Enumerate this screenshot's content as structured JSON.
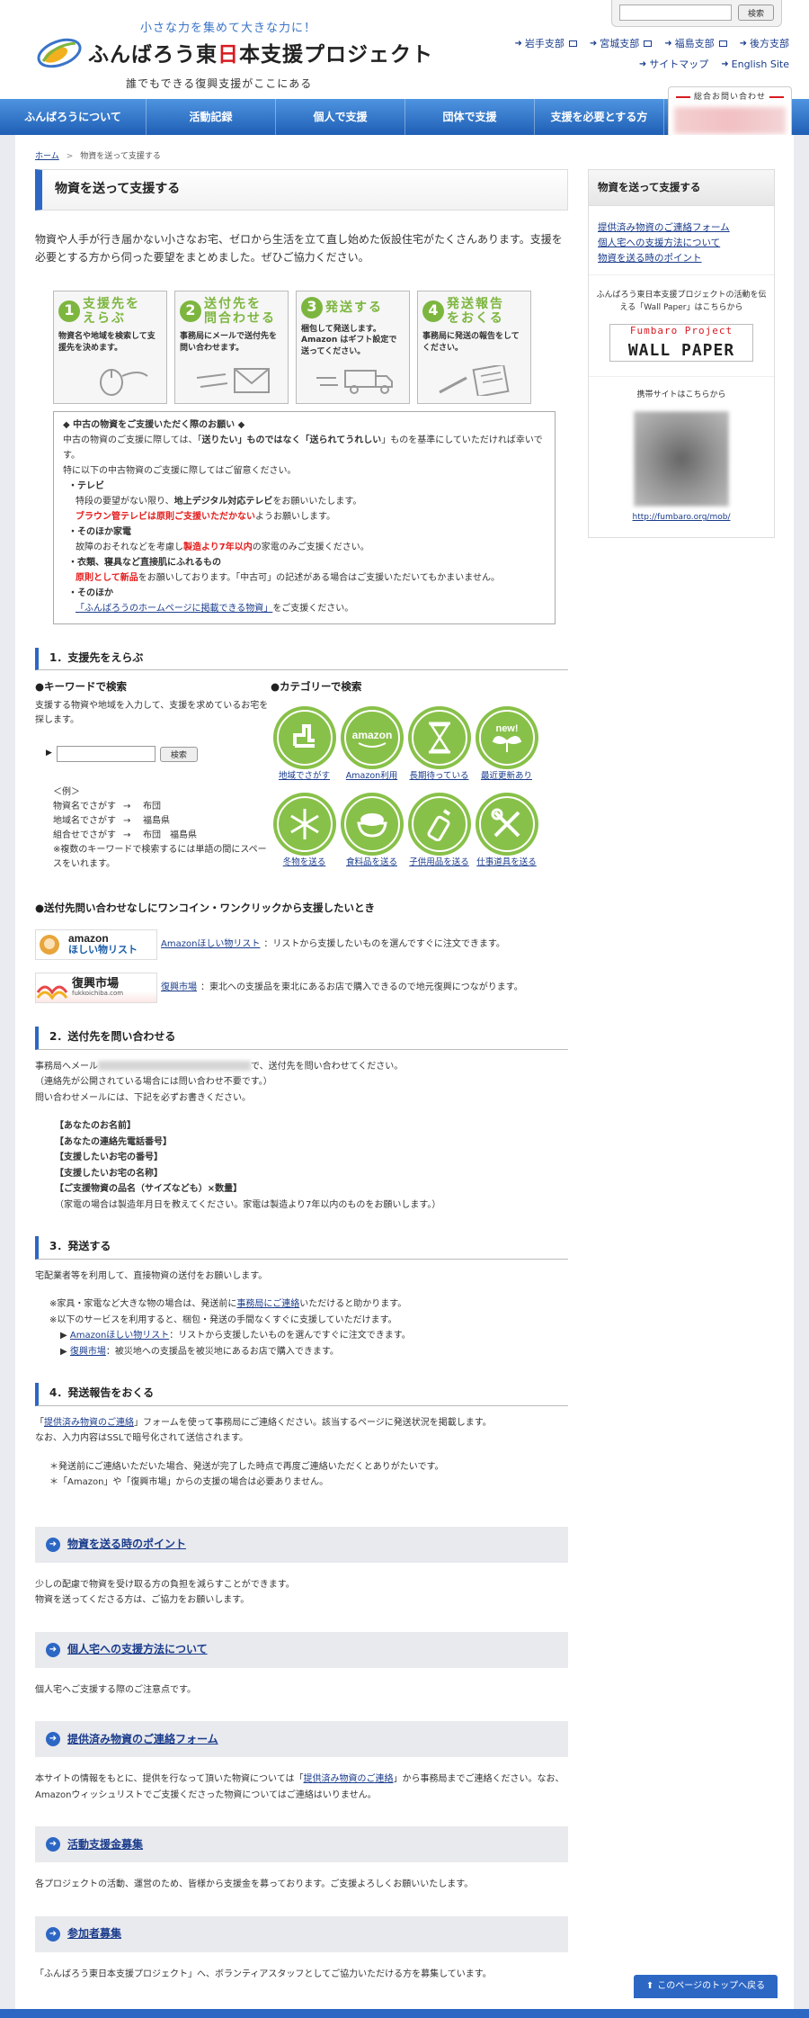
{
  "header": {
    "tagline": "小さな力を集めて大きな力に！",
    "logo_pre": "ふんばろう東",
    "logo_red": "日",
    "logo_post": "本支援プロジェクト",
    "logo_sub": "誰でもできる復興支援がここにある",
    "search_button": "検索",
    "links_row1": [
      "岩手支部",
      "宮城支部",
      "福島支部",
      "後方支部"
    ],
    "links_row2": [
      "サイトマップ",
      "English Site"
    ]
  },
  "nav": {
    "items": [
      "ふんばろうについて",
      "活動記録",
      "個人で支援",
      "団体で支援",
      "支援を必要とする方"
    ],
    "contact_label": "総合お問い合わせ"
  },
  "breadcrumb": {
    "home": "ホーム",
    "current": "物資を送って支援する"
  },
  "main": {
    "title": "物資を送って支援する",
    "intro": "物資や人手が行き届かない小さなお宅、ゼロから生活を立て直し始めた仮設住宅がたくさんあります。支援を必要とする方から伺った要望をまとめました。ぜひご協力ください。",
    "steps": [
      {
        "num": "1",
        "title": "支援先を\nえらぶ",
        "desc": "物資名や地域を検索して支援先を決めます。"
      },
      {
        "num": "2",
        "title": "送付先を\n問合わせる",
        "desc": "事務局にメールで送付先を問い合わせます。"
      },
      {
        "num": "3",
        "title": "発送する",
        "desc": "梱包して発送します。Amazon はギフト設定で送ってください。"
      },
      {
        "num": "4",
        "title": "発送報告\nをおくる",
        "desc": "事務局に発送の報告をしてください。"
      }
    ],
    "notice": {
      "title": "◆ 中古の物資をご支援いただく際のお願い ◆",
      "l1a": "中古の物資のご支援に際しては、「",
      "l1b": "送りたい」ものではなく「送られてうれしい",
      "l1c": "」ものを基準にしていただければ幸いです。",
      "l2": "特に以下の中古物資のご支援に際してはご留意ください。",
      "tv_h": "・テレビ",
      "tv_1a": "特段の要望がない限り、",
      "tv_1b": "地上デジタル対応テレビ",
      "tv_1c": "をお願いいたします。",
      "tv_2a": "ブラウン管テレビは原則ご支援いただかない",
      "tv_2b": "ようお願いします。",
      "ap_h": "・そのほか家電",
      "ap_1a": "故障のおそれなどを考慮し",
      "ap_1b": "製造より7年以内",
      "ap_1c": "の家電のみご支援ください。",
      "cl_h": "・衣類、寝具など直接肌にふれるもの",
      "cl_1a": "原則として新品",
      "cl_1b": "をお願いしております。「中古可」の記述がある場合はご支援いただいてもかまいません。",
      "ot_h": "・そのほか",
      "ot_link": "「ふんばろうのホームページに掲載できる物資」",
      "ot_tail": "をご支援ください。"
    },
    "sec1": {
      "heading": "1．支援先をえらぶ",
      "kw_title": "●キーワードで検索",
      "kw_desc": "支援する物資や地域を入力して、支援を求めているお宅を探します。",
      "kw_button": "検索",
      "ex_head": "＜例＞",
      "ex_rows": [
        [
          "物資名でさがす",
          "→",
          "布団"
        ],
        [
          "地域名でさがす",
          "→",
          "福島県"
        ],
        [
          "組合せでさがす",
          "→",
          "布団　福島県"
        ]
      ],
      "ex_note": "※複数のキーワードで検索するには単語の間にスペースをいれます。",
      "cat_title": "●カテゴリーで検索",
      "categories": [
        {
          "label": "地域でさがす",
          "icon": "map-icon"
        },
        {
          "label": "Amazon利用",
          "icon": "amazon-icon"
        },
        {
          "label": "長期待っている",
          "icon": "hourglass-icon"
        },
        {
          "label": "最近更新あり",
          "icon": "new-icon"
        },
        {
          "label": "冬物を送る",
          "icon": "snowflake-icon"
        },
        {
          "label": "食料品を送る",
          "icon": "rice-bowl-icon"
        },
        {
          "label": "子供用品を送る",
          "icon": "baby-bottle-icon"
        },
        {
          "label": "仕事道具を送る",
          "icon": "tools-icon"
        }
      ],
      "oneclick_title": "●送付先問い合わせなしにワンコイン・ワンクリックから支援したいとき",
      "amazon_logo_1": "amazon",
      "amazon_logo_2": "ほしい物リスト",
      "amazon_link": "Amazonほしい物リスト",
      "amazon_desc": "：リストから支援したいものを選んですぐに注文できます。",
      "fukko_logo": "復興市場",
      "fukko_logo_sub": "fukkoichiba.com",
      "fukko_link": "復興市場",
      "fukko_desc": "：東北への支援品を東北にあるお店で購入できるので地元復興につながります。"
    },
    "sec2": {
      "heading": "2．送付先を問い合わせる",
      "l1a": "事務局へメール",
      "l1b": "で、送付先を問い合わせてください。",
      "l2": "（連絡先が公開されている場合には問い合わせ不要です。）",
      "l3": "問い合わせメールには、下記を必ずお書きください。",
      "items": [
        "【あなたのお名前】",
        "【あなたの連絡先電話番号】",
        "【支援したいお宅の番号】",
        "【支援したいお宅の名称】",
        "【ご支援物資の品名（サイズなども）×数量】"
      ],
      "note": "（家電の場合は製造年月日を教えてください。家電は製造より7年以内のものをお願いします。）"
    },
    "sec3": {
      "heading": "3．発送する",
      "l1": "宅配業者等を利用して、直接物資の送付をお願いします。",
      "n1a": "※家具・家電など大きな物の場合は、発送前に",
      "n1link": "事務局にご連絡",
      "n1b": "いただけると助かります。",
      "n2": "※以下のサービスを利用すると、梱包・発送の手間なくすぐに支援していただけます。",
      "s1link": "Amazonほしい物リスト",
      "s1": "：リストから支援したいものを選んですぐに注文できます。",
      "s2link": "復興市場",
      "s2": "：被災地への支援品を被災地にあるお店で購入できます。"
    },
    "sec4": {
      "heading": "4．発送報告をおくる",
      "l1a": "「",
      "l1link": "提供済み物資のご連絡",
      "l1b": "」フォームを使って事務局にご連絡ください。該当するページに発送状況を掲載します。",
      "l2": "なお、入力内容はSSLで暗号化されて送信されます。",
      "n1": "＊発送前にご連絡いただいた場合、発送が完了した時点で再度ご連絡いただくとありがたいです。",
      "n2": "＊「Amazon」や「復興市場」からの支援の場合は必要ありません。"
    },
    "bars": [
      {
        "label": "物資を送る時のポイント",
        "text": "少しの配慮で物資を受け取る方の負担を減らすことができます。\n物資を送ってくださる方は、ご協力をお願いします。"
      },
      {
        "label": "個人宅への支援方法について",
        "text": "個人宅へご支援する際のご注意点です。"
      },
      {
        "label": "提供済み物資のご連絡フォーム",
        "text": ""
      },
      {
        "label": "活動支援金募集",
        "text": "各プロジェクトの活動、運営のため、皆様から支援金を募っております。ご支援よろしくお願いいたします。"
      },
      {
        "label": "参加者募集",
        "text": "「ふんばろう東日本支援プロジェクト」へ、ボランティアスタッフとしてご協力いただける方を募集しています。"
      }
    ],
    "form_text_a": "本サイトの情報をもとに、提供を行なって頂いた物資については「",
    "form_text_link": "提供済み物資のご連絡",
    "form_text_b": "」から事務局までご連絡ください。なお、Amazonウィッシュリストでご支援くださった物資についてはご連絡はいりません。"
  },
  "sidebar": {
    "title": "物資を送って支援する",
    "links": [
      "提供済み物資のご連絡フォーム",
      "個人宅への支援方法について",
      "物資を送る時のポイント"
    ],
    "wp_text": "ふんばろう東日本支援プロジェクトの活動を伝える「Wall Paper」はこちらから",
    "wp_logo_1": "Fumbaro Project",
    "wp_logo_2": "WALL PAPER",
    "mob_text": "携帯サイトはこちらから",
    "mob_url": "http://fumbaro.org/mob/"
  },
  "footer": {
    "totop": "このページのトップへ戻る"
  },
  "colors": {
    "brand_blue": "#2d67c4",
    "accent_green": "#88c149",
    "alert_red": "#e41d1d"
  }
}
